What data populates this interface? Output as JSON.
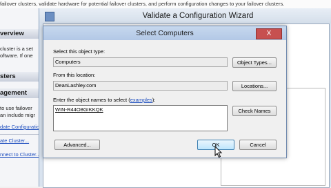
{
  "background": {
    "top_text": "failover clusters, validate hardware for potential failover clusters, and perform configuration changes to your failover clusters.",
    "overview_header": "verview",
    "cluster_text_1": "cluster is a set",
    "cluster_text_2": "oftware. If one",
    "clusters_header": "sters",
    "management_header": "agement",
    "mgmt_text_1": "to use failover",
    "mgmt_text_2": "an include migr",
    "link_validate": "date Configuratio",
    "link_create": "ate Cluster...",
    "link_connect": "nnect to Cluster..."
  },
  "wizard": {
    "title": "Validate a Configuration Wizard"
  },
  "dialog": {
    "title": "Select Computers",
    "close_label": "X",
    "object_type_label": "Select this object type:",
    "object_type_value": "Computers",
    "object_types_button": "Object Types...",
    "location_label": "From this location:",
    "location_value": "DeanLashley.com",
    "locations_button": "Locations...",
    "names_label_prefix": "Enter the object names to select (",
    "names_label_link": "examples",
    "names_label_suffix": "):",
    "names_value": "WIN-R44O8GIKKQK",
    "check_names_button": "Check Names",
    "advanced_button": "Advanced...",
    "ok_button": "OK",
    "cancel_button": "Cancel"
  }
}
